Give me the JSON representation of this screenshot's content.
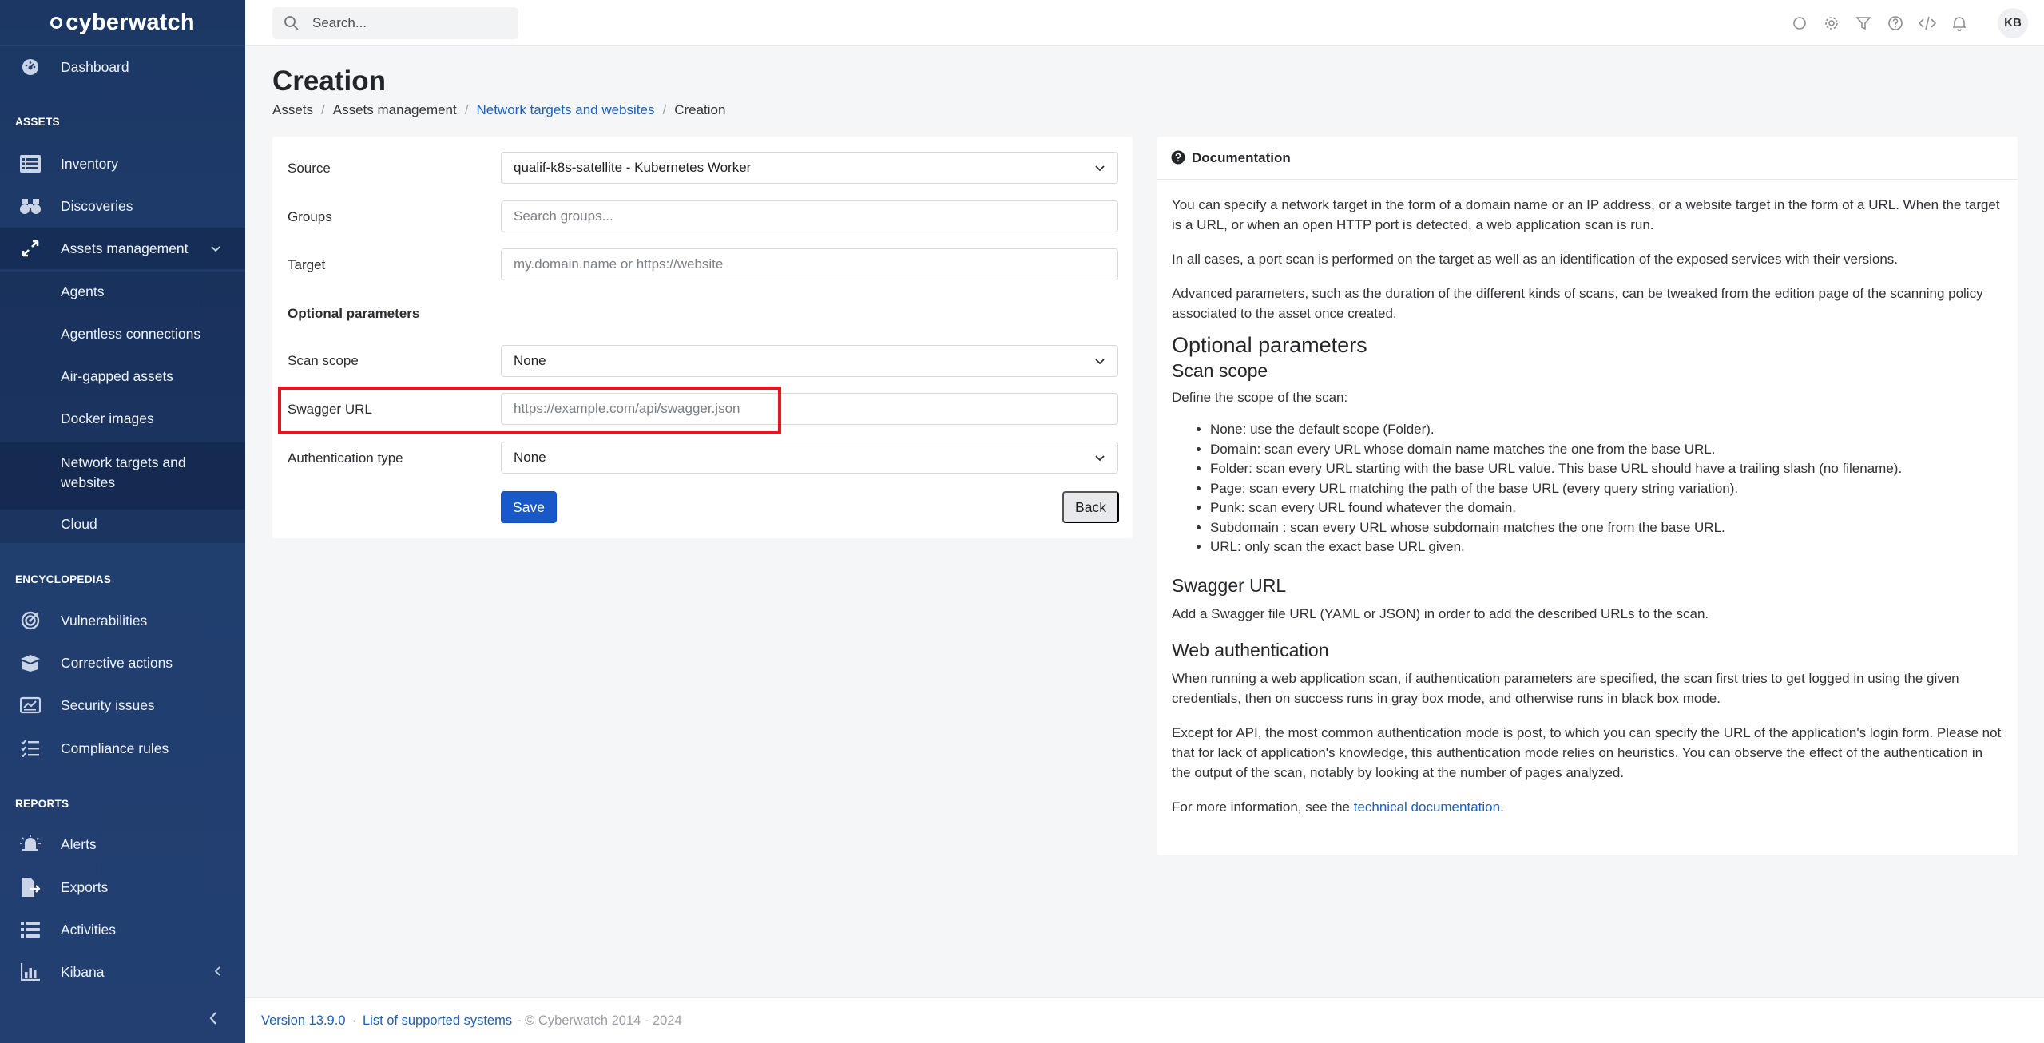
{
  "brand": {
    "name": "cyberwatch"
  },
  "sidebar": {
    "dashboard": "Dashboard",
    "sections": {
      "assets": "ASSETS",
      "encyclopedias": "ENCYCLOPEDIAS",
      "reports": "REPORTS"
    },
    "assets_items": [
      "Inventory",
      "Discoveries",
      "Assets management"
    ],
    "assets_submenu": [
      "Agents",
      "Agentless connections",
      "Air-gapped assets",
      "Docker images",
      "Network targets and",
      "websites",
      "Cloud"
    ],
    "encyclopedia_items": [
      "Vulnerabilities",
      "Corrective actions",
      "Security issues",
      "Compliance rules"
    ],
    "report_items": [
      "Alerts",
      "Exports",
      "Activities",
      "Kibana"
    ]
  },
  "topbar": {
    "search_placeholder": "Search...",
    "avatar": "KB"
  },
  "header": {
    "title": "Creation",
    "breadcrumb": [
      "Assets",
      "Assets management",
      "Network targets and websites",
      "Creation"
    ]
  },
  "form": {
    "source_label": "Source",
    "source_value": "qualif-k8s-satellite - Kubernetes Worker",
    "groups_label": "Groups",
    "groups_placeholder": "Search groups...",
    "target_label": "Target",
    "target_placeholder": "my.domain.name or https://website",
    "optional_heading": "Optional parameters",
    "scan_scope_label": "Scan scope",
    "scan_scope_value": "None",
    "swagger_label": "Swagger URL",
    "swagger_placeholder": "https://example.com/api/swagger.json",
    "auth_label": "Authentication type",
    "auth_value": "None",
    "save": "Save",
    "back": "Back"
  },
  "doc": {
    "title": "Documentation",
    "p1": "You can specify a network target in the form of a domain name or an IP address, or a website target in the form of a URL. When the target is a URL, or when an open HTTP port is detected, a web application scan is run.",
    "p2": "In all cases, a port scan is performed on the target as well as an identification of the exposed services with their versions.",
    "p3": "Advanced parameters, such as the duration of the different kinds of scans, can be tweaked from the edition page of the scanning policy associated to the asset once created.",
    "h_optional": "Optional parameters",
    "h_scope": "Scan scope",
    "scope_intro": "Define the scope of the scan:",
    "scope_items": [
      "None: use the default scope (Folder).",
      "Domain: scan every URL whose domain name matches the one from the base URL.",
      "Folder: scan every URL starting with the base URL value. This base URL should have a trailing slash (no filename).",
      "Page: scan every URL matching the path of the base URL (every query string variation).",
      "Punk: scan every URL found whatever the domain.",
      "Subdomain : scan every URL whose subdomain matches the one from the base URL.",
      "URL: only scan the exact base URL given."
    ],
    "h_swagger": "Swagger URL",
    "swagger_text": "Add a Swagger file URL (YAML or JSON) in order to add the described URLs to the scan.",
    "h_webauth": "Web authentication",
    "webauth_p1": "When running a web application scan, if authentication parameters are specified, the scan first tries to get logged in using the given credentials, then on success runs in gray box mode, and otherwise runs in black box mode.",
    "webauth_p2": "Except for API, the most common authentication mode is post, to which you can specify the URL of the application's login form. Please not that for lack of application's knowledge, this authentication mode relies on heuristics. You can observe the effect of the authentication in the output of the scan, notably by looking at the number of pages analyzed.",
    "more_prefix": "For more information, see the ",
    "more_link": "technical documentation",
    "more_suffix": "."
  },
  "footer": {
    "version": "Version 13.9.0",
    "systems": "List of supported systems",
    "copyright": "- © Cyberwatch 2014 - 2024"
  }
}
